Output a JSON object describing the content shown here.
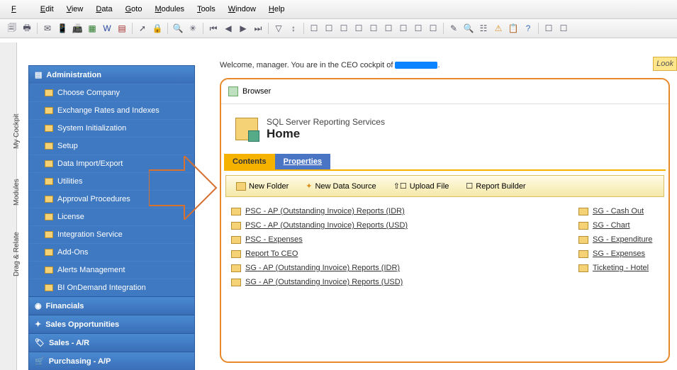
{
  "menubar": [
    "File",
    "Edit",
    "View",
    "Data",
    "Goto",
    "Modules",
    "Tools",
    "Window",
    "Help"
  ],
  "welcome": {
    "prefix": "Welcome, manager. You are in the CEO cockpit of ",
    "suffix": "."
  },
  "look_label": "Look",
  "side_tabs": {
    "cockpit": "My Cockpit",
    "modules": "Modules",
    "drag": "Drag & Relate"
  },
  "nav": {
    "header": "Administration",
    "items": [
      "Choose Company",
      "Exchange Rates and Indexes",
      "System Initialization",
      "Setup",
      "Data Import/Export",
      "Utilities",
      "Approval Procedures",
      "License",
      "Integration Service",
      "Add-Ons",
      "Alerts Management",
      "BI OnDemand Integration"
    ],
    "sections": [
      "Financials",
      "Sales Opportunities",
      "Sales - A/R",
      "Purchasing - A/P"
    ]
  },
  "browser": {
    "title": "Browser",
    "ssrs": "SQL Server Reporting Services",
    "home": "Home",
    "tabs": {
      "contents": "Contents",
      "properties": "Properties"
    },
    "actions": {
      "new_folder": "New Folder",
      "new_ds": "New Data Source",
      "upload": "Upload File",
      "rb": "Report Builder"
    },
    "col1": [
      "PSC - AP (Outstanding Invoice) Reports (IDR)",
      "PSC - AP (Outstanding Invoice) Reports (USD)",
      "PSC - Expenses",
      "Report To CEO",
      "SG - AP (Outstanding Invoice) Reports (IDR)",
      "SG - AP (Outstanding Invoice) Reports (USD)"
    ],
    "col2": [
      "SG - Cash Out",
      "SG - Chart",
      "SG - Expenditure",
      "SG - Expenses",
      "Ticketing - Hotel"
    ]
  }
}
